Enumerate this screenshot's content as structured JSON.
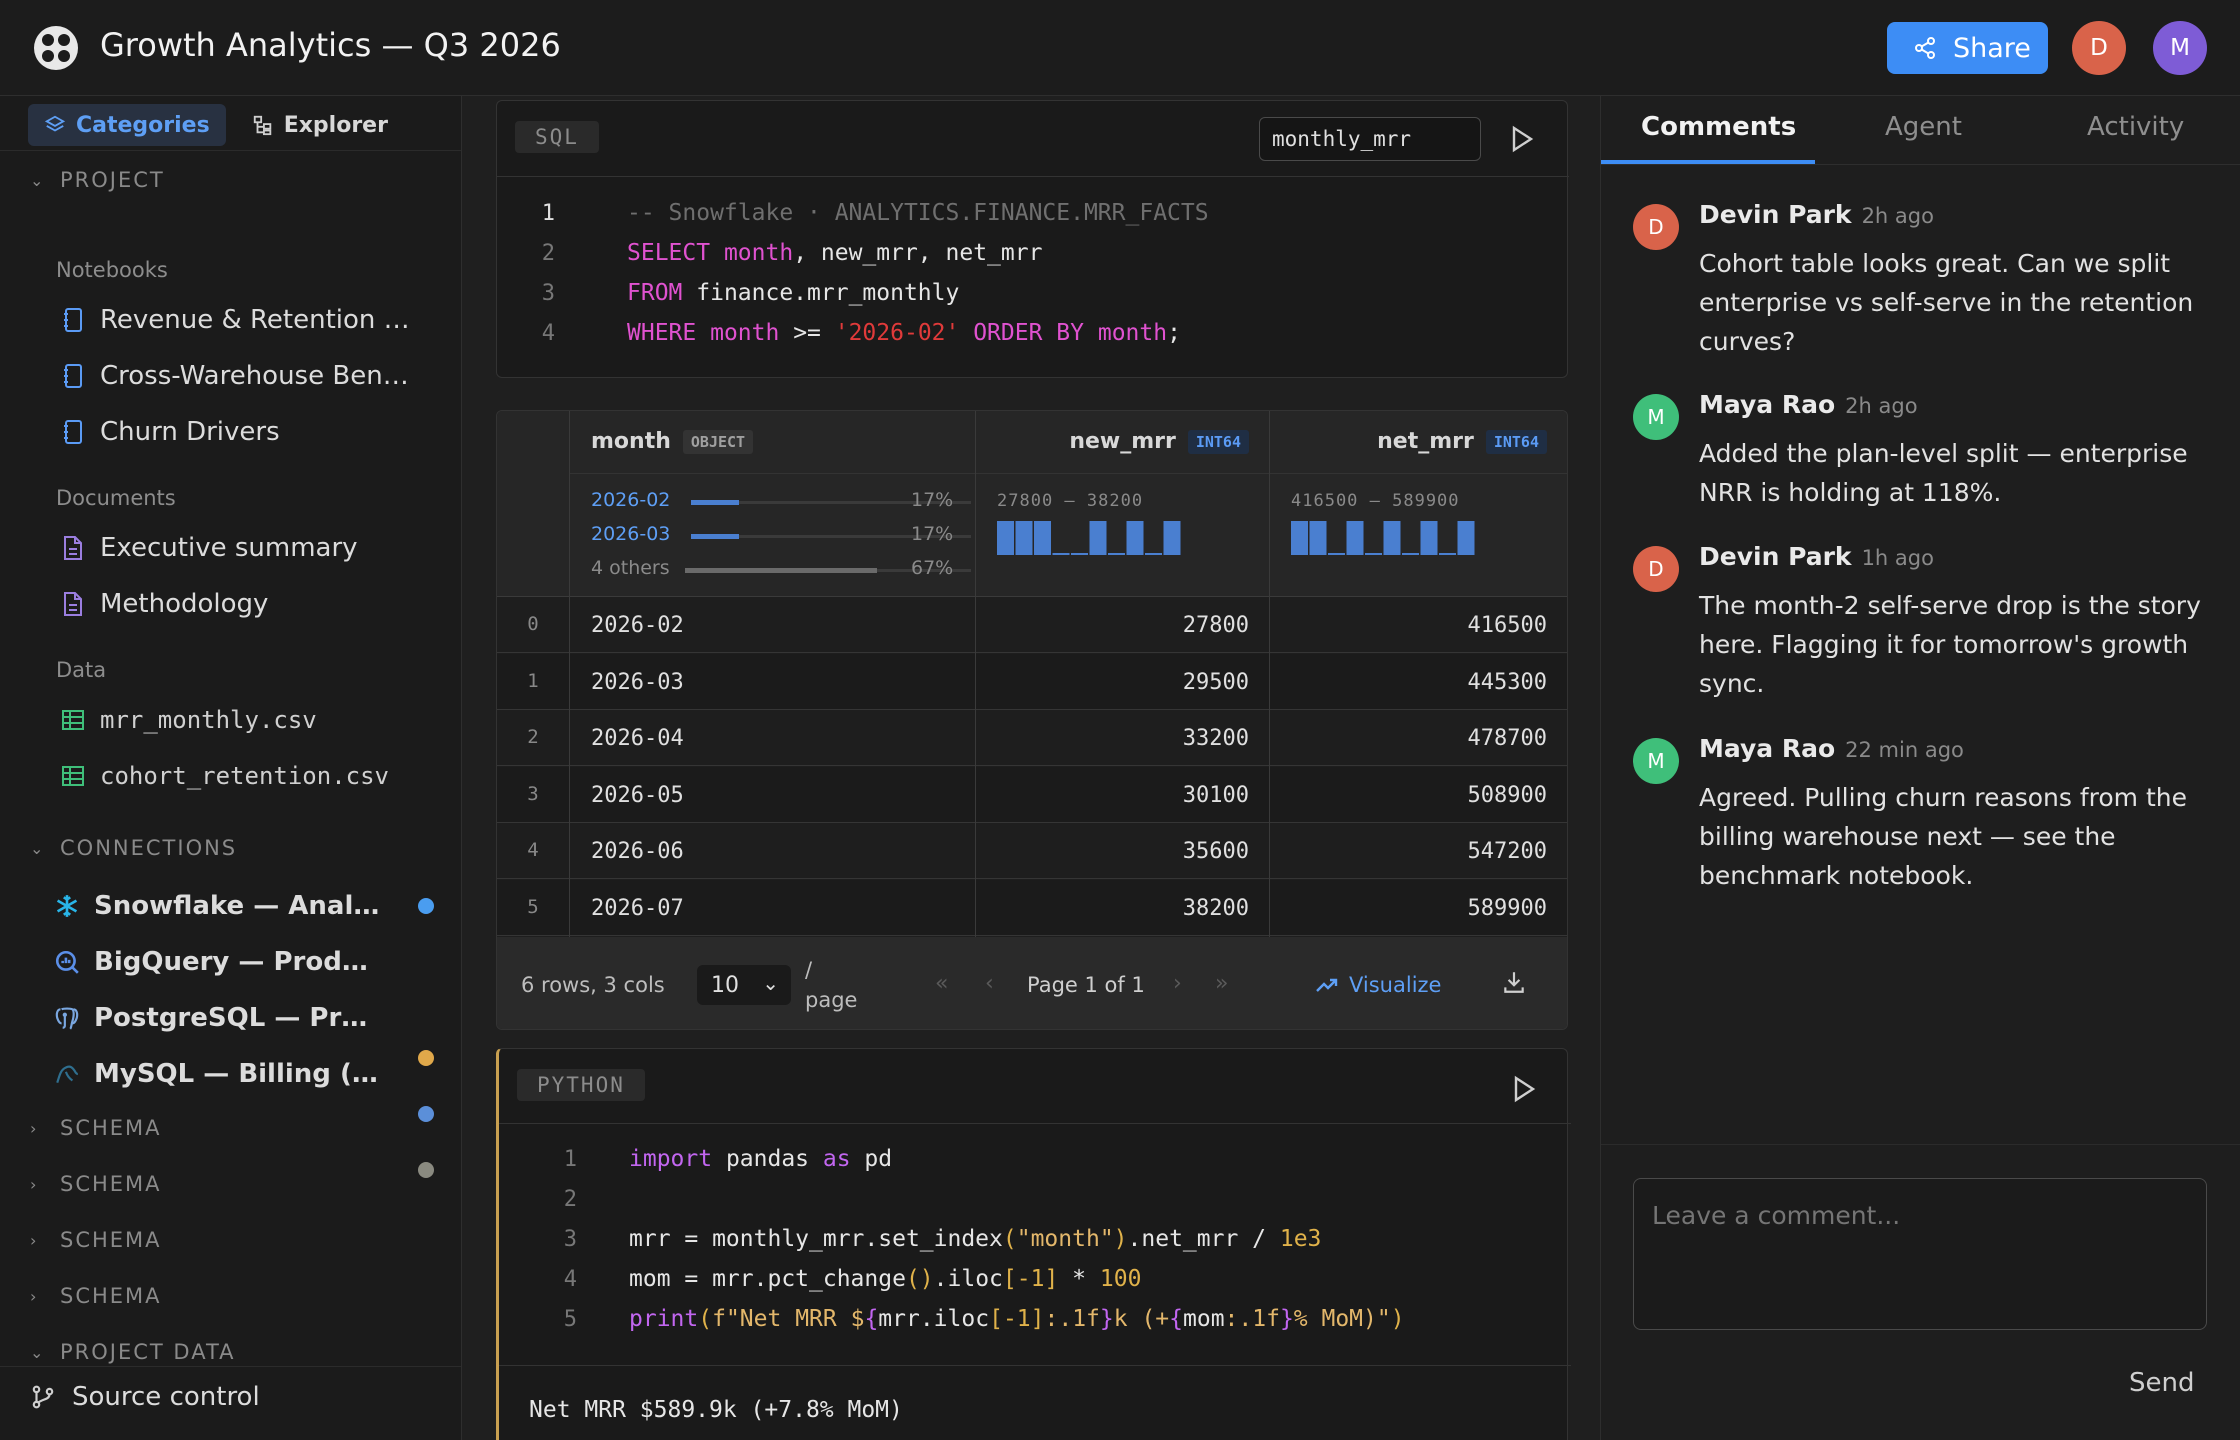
{
  "header": {
    "title": "Growth Analytics — Q3 2026",
    "share_label": "Share",
    "avatars": [
      {
        "initial": "D",
        "color": "#d9634a"
      },
      {
        "initial": "M",
        "color": "#7e5cd6"
      }
    ],
    "accent": "#3d8df5"
  },
  "sidebar": {
    "tabs": [
      {
        "label": "Categories",
        "icon": "layers-icon",
        "active": true
      },
      {
        "label": "Explorer",
        "icon": "tree-icon",
        "active": false
      }
    ],
    "project_label": "PROJECT",
    "notebooks_label": "Notebooks",
    "notebooks": [
      "Revenue & Retention Deep Dive",
      "Cross-Warehouse Benchmark",
      "Churn Drivers"
    ],
    "documents_label": "Documents",
    "documents": [
      "Executive summary",
      "Methodology"
    ],
    "data_label": "Data",
    "data_files": [
      "mrr_monthly.csv",
      "cohort_retention.csv"
    ],
    "connections_label": "CONNECTIONS",
    "connections": [
      {
        "name": "Snowflake — Analytics",
        "icon": "snowflake-icon",
        "status": "#4a9df0"
      },
      {
        "name": "BigQuery — Product Events",
        "icon": "bigquery-icon",
        "status": "#e0a84a"
      },
      {
        "name": "PostgreSQL — Prod Replica",
        "icon": "postgres-icon",
        "status": "#5b8fd9"
      },
      {
        "name": "MySQL — Billing (legacy)",
        "icon": "mysql-icon",
        "status": "#8a8a80"
      }
    ],
    "schema_labels": [
      "SCHEMA",
      "SCHEMA",
      "SCHEMA",
      "SCHEMA"
    ],
    "project_data_label": "PROJECT DATA",
    "source_control_label": "Source control"
  },
  "sql_cell": {
    "label": "SQL",
    "output_name": "monthly_mrr",
    "lines": [
      {
        "n": "1",
        "parts": [
          [
            "cm",
            "-- Snowflake · ANALYTICS.FINANCE.MRR_FACTS"
          ]
        ]
      },
      {
        "n": "2",
        "parts": [
          [
            "kw",
            "SELECT "
          ],
          [
            "kw",
            "month"
          ],
          [
            "",
            ", new_mrr, net_mrr"
          ]
        ]
      },
      {
        "n": "3",
        "parts": [
          [
            "kw",
            "FROM "
          ],
          [
            "",
            "finance.mrr_monthly"
          ]
        ]
      },
      {
        "n": "4",
        "parts": [
          [
            "kw",
            "WHERE "
          ],
          [
            "kw",
            "month"
          ],
          [
            "",
            " >= "
          ],
          [
            "str",
            "'2026-02'"
          ],
          [
            "kw",
            " ORDER BY "
          ],
          [
            "kw",
            "month"
          ],
          [
            "",
            ";"
          ]
        ]
      }
    ]
  },
  "result": {
    "columns": [
      {
        "name": "month",
        "dtype": "OBJECT"
      },
      {
        "name": "new_mrr",
        "dtype": "INT64"
      },
      {
        "name": "net_mrr",
        "dtype": "INT64"
      }
    ],
    "month_summary": [
      {
        "label": "2026-02",
        "pct": "17%",
        "fraction": 0.17
      },
      {
        "label": "2026-03",
        "pct": "17%",
        "fraction": 0.17
      },
      {
        "label": "4 others",
        "pct": "67%",
        "fraction": 0.67
      }
    ],
    "new_mrr_range": "27800 — 38200",
    "net_mrr_range": "416500 — 589900",
    "rows": [
      {
        "idx": "0",
        "month": "2026-02",
        "new_mrr": "27800",
        "net_mrr": "416500"
      },
      {
        "idx": "1",
        "month": "2026-03",
        "new_mrr": "29500",
        "net_mrr": "445300"
      },
      {
        "idx": "2",
        "month": "2026-04",
        "new_mrr": "33200",
        "net_mrr": "478700"
      },
      {
        "idx": "3",
        "month": "2026-05",
        "new_mrr": "30100",
        "net_mrr": "508900"
      },
      {
        "idx": "4",
        "month": "2026-06",
        "new_mrr": "35600",
        "net_mrr": "547200"
      },
      {
        "idx": "5",
        "month": "2026-07",
        "new_mrr": "38200",
        "net_mrr": "589900"
      }
    ],
    "footer": {
      "summary": "6 rows, 3 cols",
      "page_size": "10",
      "per_page": "/ page",
      "page_label": "Page 1 of 1",
      "visualize": "Visualize"
    }
  },
  "python_cell": {
    "label": "PYTHON",
    "lines": [
      {
        "n": "1",
        "parts": [
          [
            "fn",
            "import"
          ],
          [
            "",
            " pandas "
          ],
          [
            "fn",
            "as"
          ],
          [
            "",
            " pd"
          ]
        ]
      },
      {
        "n": "2",
        "parts": []
      },
      {
        "n": "3",
        "parts": [
          [
            "",
            "mrr = monthly_mrr.set_index"
          ],
          [
            "brk",
            "("
          ],
          [
            "pstr",
            "\"month\""
          ],
          [
            "brk",
            ")"
          ],
          [
            "",
            ".net_mrr / "
          ],
          [
            "num",
            "1e3"
          ]
        ]
      },
      {
        "n": "4",
        "parts": [
          [
            "",
            "mom = mrr.pct_change"
          ],
          [
            "brk",
            "()"
          ],
          [
            "",
            ".iloc"
          ],
          [
            "brk",
            "["
          ],
          [
            "num",
            "-1"
          ],
          [
            "brk",
            "]"
          ],
          [
            "",
            " * "
          ],
          [
            "num",
            "100"
          ]
        ]
      },
      {
        "n": "5",
        "parts": [
          [
            "fn",
            "print"
          ],
          [
            "brk",
            "("
          ],
          [
            "pstr",
            "f\"Net MRR $"
          ],
          [
            "fn",
            "{"
          ],
          [
            "",
            "mrr.iloc"
          ],
          [
            "brk",
            "["
          ],
          [
            "num",
            "-1"
          ],
          [
            "brk",
            "]"
          ],
          [
            "pstr",
            ":.1f"
          ],
          [
            "fn",
            "}"
          ],
          [
            "pstr",
            "k (+"
          ],
          [
            "fn",
            "{"
          ],
          [
            "",
            "mom"
          ],
          [
            "pstr",
            ":.1f"
          ],
          [
            "fn",
            "}"
          ],
          [
            "pstr",
            "% MoM)\""
          ],
          [
            "brk",
            ")"
          ]
        ]
      }
    ],
    "output": "Net MRR $589.9k (+7.8% MoM)"
  },
  "right_panel": {
    "tabs": [
      "Comments",
      "Agent",
      "Activity"
    ],
    "comments": [
      {
        "author": "Devin Park",
        "initial": "D",
        "color": "#d9634a",
        "time": "2h ago",
        "text": "Cohort table looks great. Can we split enterprise vs self-serve in the retention curves?"
      },
      {
        "author": "Maya Rao",
        "initial": "M",
        "color": "#3fbf7a",
        "time": "2h ago",
        "text": "Added the plan-level split — enterprise NRR is holding at 118%."
      },
      {
        "author": "Devin Park",
        "initial": "D",
        "color": "#d9634a",
        "time": "1h ago",
        "text": "The month-2 self-serve drop is the story here. Flagging it for tomorrow's growth sync."
      },
      {
        "author": "Maya Rao",
        "initial": "M",
        "color": "#3fbf7a",
        "time": "22 min ago",
        "text": "Agreed. Pulling churn reasons from the billing warehouse next — see the benchmark notebook."
      }
    ],
    "comment_placeholder": "Leave a comment...",
    "send_label": "Send"
  }
}
